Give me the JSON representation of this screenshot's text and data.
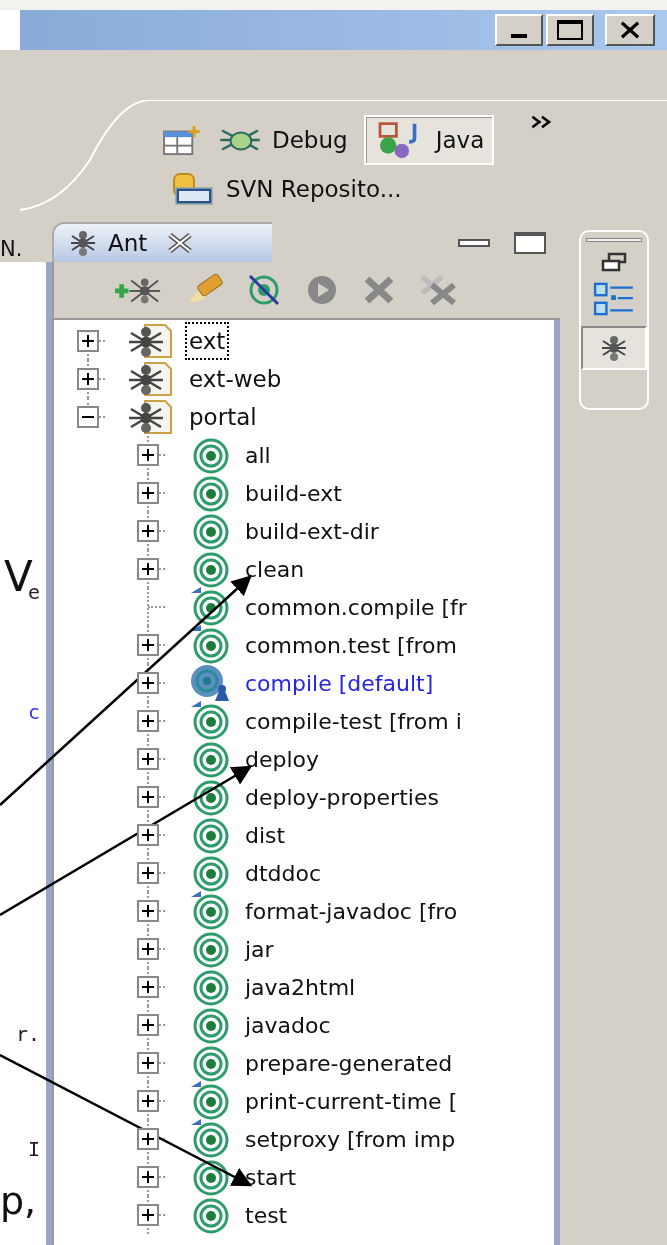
{
  "perspectives": [
    {
      "label": "Debug",
      "kind": "debug",
      "selected": false
    },
    {
      "label": "Java",
      "kind": "java",
      "selected": true
    },
    {
      "label": "SVN Reposito...",
      "kind": "svn",
      "selected": false
    }
  ],
  "editor": {
    "tab_label": "N.",
    "fragments": [
      {
        "text": "e",
        "kind": "code"
      },
      {
        "text": "c",
        "kind": "keyword"
      },
      {
        "text": "r.",
        "kind": "code"
      },
      {
        "text": "I",
        "kind": "code"
      }
    ]
  },
  "annotation_texts": [
    "V",
    "p,"
  ],
  "ant_view": {
    "title": "Ant",
    "tree": [
      {
        "label": "ext",
        "expanded": false,
        "focused": true
      },
      {
        "label": "ext-web",
        "expanded": false,
        "focused": false
      },
      {
        "label": "portal",
        "expanded": true,
        "focused": false,
        "children": [
          {
            "label": "all",
            "kind": "target",
            "expandable": true,
            "annotated": false
          },
          {
            "label": "build-ext",
            "kind": "target",
            "expandable": true,
            "annotated": false
          },
          {
            "label": "build-ext-dir",
            "kind": "target",
            "expandable": true,
            "annotated": false
          },
          {
            "label": "clean",
            "kind": "target",
            "expandable": true,
            "annotated": true
          },
          {
            "label": "common.compile [fr",
            "kind": "imported",
            "expandable": false,
            "annotated": false
          },
          {
            "label": "common.test [from",
            "kind": "imported",
            "expandable": true,
            "annotated": false
          },
          {
            "label": "compile [default]",
            "kind": "default",
            "expandable": true,
            "annotated": false
          },
          {
            "label": "compile-test [from i",
            "kind": "imported",
            "expandable": true,
            "annotated": false
          },
          {
            "label": "deploy",
            "kind": "target",
            "expandable": true,
            "annotated": true
          },
          {
            "label": "deploy-properties",
            "kind": "target",
            "expandable": true,
            "annotated": false
          },
          {
            "label": "dist",
            "kind": "target",
            "expandable": true,
            "annotated": false
          },
          {
            "label": "dtddoc",
            "kind": "target",
            "expandable": true,
            "annotated": false
          },
          {
            "label": "format-javadoc [fro",
            "kind": "imported",
            "expandable": true,
            "annotated": false
          },
          {
            "label": "jar",
            "kind": "target",
            "expandable": true,
            "annotated": false
          },
          {
            "label": "java2html",
            "kind": "target",
            "expandable": true,
            "annotated": false
          },
          {
            "label": "javadoc",
            "kind": "target",
            "expandable": true,
            "annotated": false
          },
          {
            "label": "prepare-generated",
            "kind": "target",
            "expandable": true,
            "annotated": false
          },
          {
            "label": "print-current-time [",
            "kind": "imported",
            "expandable": true,
            "annotated": false
          },
          {
            "label": "setproxy [from imp",
            "kind": "imported",
            "expandable": true,
            "annotated": false
          },
          {
            "label": "start",
            "kind": "target",
            "expandable": true,
            "annotated": true
          },
          {
            "label": "test",
            "kind": "target",
            "expandable": true,
            "annotated": false
          }
        ]
      }
    ]
  }
}
